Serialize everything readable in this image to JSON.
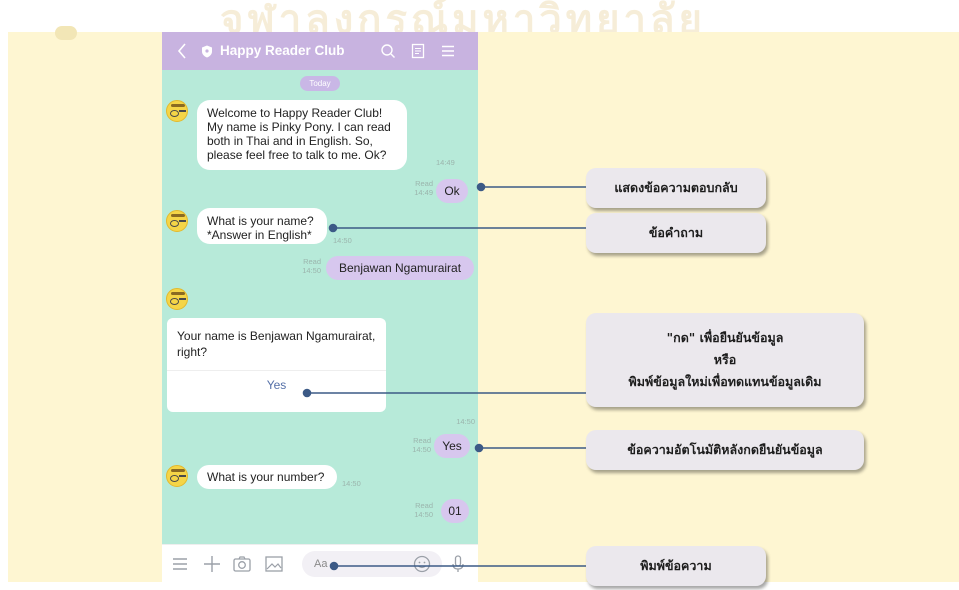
{
  "watermark": "จุฬาลงกรณ์มหาวิทยาลัย",
  "colors": {
    "accent_line": "#3c5a86",
    "phone_bg": "#b7ead9",
    "header": "#c8b3e0",
    "outgoing_bubble": "#d7c7ee",
    "page_bg": "#fef6d2"
  },
  "chat_header": {
    "title": "Happy Reader Club",
    "icons": [
      "back-chevron-icon",
      "shield-icon",
      "search-icon",
      "notes-icon",
      "menu-icon"
    ]
  },
  "date_chip": "Today",
  "messages": {
    "welcome": {
      "text": "Welcome to Happy Reader Club!\nMy name is Pinky Pony. I can read both in Thai and in English. So, please feel free to talk to me. Ok?",
      "time": "14:49"
    },
    "ok_reply": {
      "text": "Ok",
      "read": "Read",
      "time": "14:49"
    },
    "name_q": {
      "text": "What is your name?\n*Answer in English*",
      "time": "14:50"
    },
    "name_reply": {
      "text": "Benjawan Ngamurairat",
      "read": "Read",
      "time": "14:50"
    },
    "confirm_card": {
      "question": "Your name is Benjawan Ngamurairat, right?",
      "button": "Yes"
    },
    "confirm_time": "14:50",
    "yes_reply": {
      "text": "Yes",
      "read": "Read",
      "time": "14:50"
    },
    "number_q": {
      "text": "What is your number?",
      "time": "14:50"
    },
    "num_reply": {
      "text": "01",
      "read": "Read",
      "time": "14:50"
    }
  },
  "input_bar": {
    "placeholder": "Aa",
    "icons": [
      "list-icon",
      "plus-icon",
      "camera-icon",
      "image-icon",
      "emoji-icon",
      "mic-icon"
    ]
  },
  "callouts": {
    "c1": "แสดงข้อความตอบกลับ",
    "c2": "ข้อคำถาม",
    "c3_line1": "\"กด\" เพื่อยืนยันข้อมูล",
    "c3_line2": "หรือ",
    "c3_line3": "พิมพ์ข้อมูลใหม่เพื่อทดแทนข้อมูลเดิม",
    "c4": "ข้อความอัตโนมัติหลังกดยืนยันข้อมูล",
    "c5": "พิมพ์ข้อความ"
  }
}
